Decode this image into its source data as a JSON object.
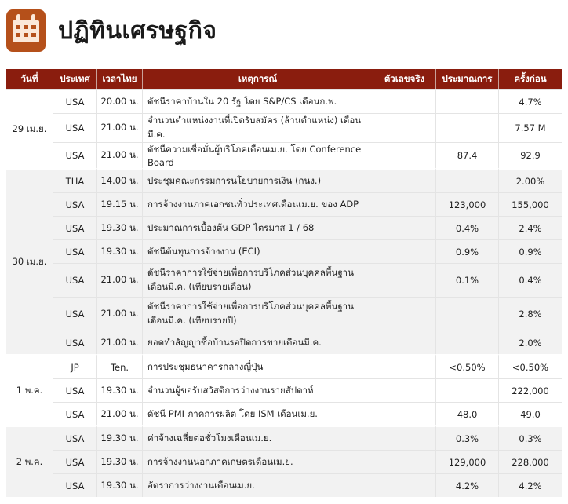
{
  "title": "ปฏิทินเศรษฐกิจ",
  "headers": [
    "วันที่",
    "ประเทศ",
    "เวลาไทย",
    "เหตุการณ์",
    "ตัวเลขจริง",
    "ประมาณการ",
    "ครั้งก่อน"
  ],
  "groups": [
    {
      "date": "29 เม.ย.",
      "rows": [
        {
          "country": "USA",
          "time": "20.00 น.",
          "event": "ดัชนีราคาบ้านใน 20 รัฐ โดย S&P/CS เดือนก.พ.",
          "actual": "",
          "forecast": "",
          "previous": "4.7%"
        },
        {
          "country": "USA",
          "time": "21.00 น.",
          "event": "จำนวนตำแหน่งงานที่เปิดรับสมัคร (ล้านตำแหน่ง) เดือนมี.ค.",
          "actual": "",
          "forecast": "",
          "previous": "7.57 M"
        },
        {
          "country": "USA",
          "time": "21.00 น.",
          "event": "ดัชนีความเชื่อมั่นผู้บริโภคเดือนเม.ย. โดย Conference Board",
          "actual": "",
          "forecast": "87.4",
          "previous": "92.9"
        }
      ]
    },
    {
      "date": "30 เม.ย.",
      "rows": [
        {
          "country": "THA",
          "time": "14.00 น.",
          "event": "ประชุมคณะกรรมการนโยบายการเงิน (กนง.)",
          "actual": "",
          "forecast": "",
          "previous": "2.00%"
        },
        {
          "country": "USA",
          "time": "19.15 น.",
          "event": "การจ้างงานภาคเอกชนทั่วประเทศเดือนเม.ย. ของ ADP",
          "actual": "",
          "forecast": "123,000",
          "previous": "155,000"
        },
        {
          "country": "USA",
          "time": "19.30 น.",
          "event": "ประมาณการเบื้องต้น GDP ไตรมาส 1 / 68",
          "actual": "",
          "forecast": "0.4%",
          "previous": "2.4%"
        },
        {
          "country": "USA",
          "time": "19.30 น.",
          "event": "ดัชนีต้นทุนการจ้างงาน (ECI)",
          "actual": "",
          "forecast": "0.9%",
          "previous": "0.9%"
        },
        {
          "country": "USA",
          "time": "21.00 น.",
          "event_line1": "ดัชนีราคาการใช้จ่ายเพื่อการบริโภคส่วนบุคคลพื้นฐาน",
          "event_line2": "เดือนมี.ค. (เทียบรายเดือน)",
          "actual": "",
          "forecast": "0.1%",
          "previous": "0.4%"
        },
        {
          "country": "USA",
          "time": "21.00 น.",
          "event_line1": "ดัชนีราคาการใช้จ่ายเพื่อการบริโภคส่วนบุคคลพื้นฐาน",
          "event_line2": "เดือนมี.ค. (เทียบรายปี)",
          "actual": "",
          "forecast": "",
          "previous": "2.8%"
        },
        {
          "country": "USA",
          "time": "21.00 น.",
          "event": "ยอดทำสัญญาซื้อบ้านรอปิดการขายเดือนมี.ค.",
          "actual": "",
          "forecast": "",
          "previous": "2.0%"
        }
      ]
    },
    {
      "date": "1 พ.ค.",
      "rows": [
        {
          "country": "JP",
          "time": "Ten.",
          "event": "การประชุมธนาคารกลางญี่ปุ่น",
          "actual": "",
          "forecast": "<0.50%",
          "previous": "<0.50%"
        },
        {
          "country": "USA",
          "time": "19.30 น.",
          "event": "จำนวนผู้ขอรับสวัสดิการว่างงานรายสัปดาห์",
          "actual": "",
          "forecast": "",
          "previous": "222,000"
        },
        {
          "country": "USA",
          "time": "21.00 น.",
          "event": "ดัชนี PMI ภาคการผลิต โดย ISM เดือนเม.ย.",
          "actual": "",
          "forecast": "48.0",
          "previous": "49.0"
        }
      ]
    },
    {
      "date": "2 พ.ค.",
      "rows": [
        {
          "country": "USA",
          "time": "19.30 น.",
          "event": "ค่าจ้างเฉลี่ยต่อชั่วโมงเดือนเม.ย.",
          "actual": "",
          "forecast": "0.3%",
          "previous": "0.3%"
        },
        {
          "country": "USA",
          "time": "19.30 น.",
          "event": "การจ้างงานนอกภาคเกษตรเดือนเม.ย.",
          "actual": "",
          "forecast": "129,000",
          "previous": "228,000"
        },
        {
          "country": "USA",
          "time": "19.30 น.",
          "event": "อัตราการว่างงานเดือนเม.ย.",
          "actual": "",
          "forecast": "4.2%",
          "previous": "4.2%"
        }
      ]
    }
  ]
}
